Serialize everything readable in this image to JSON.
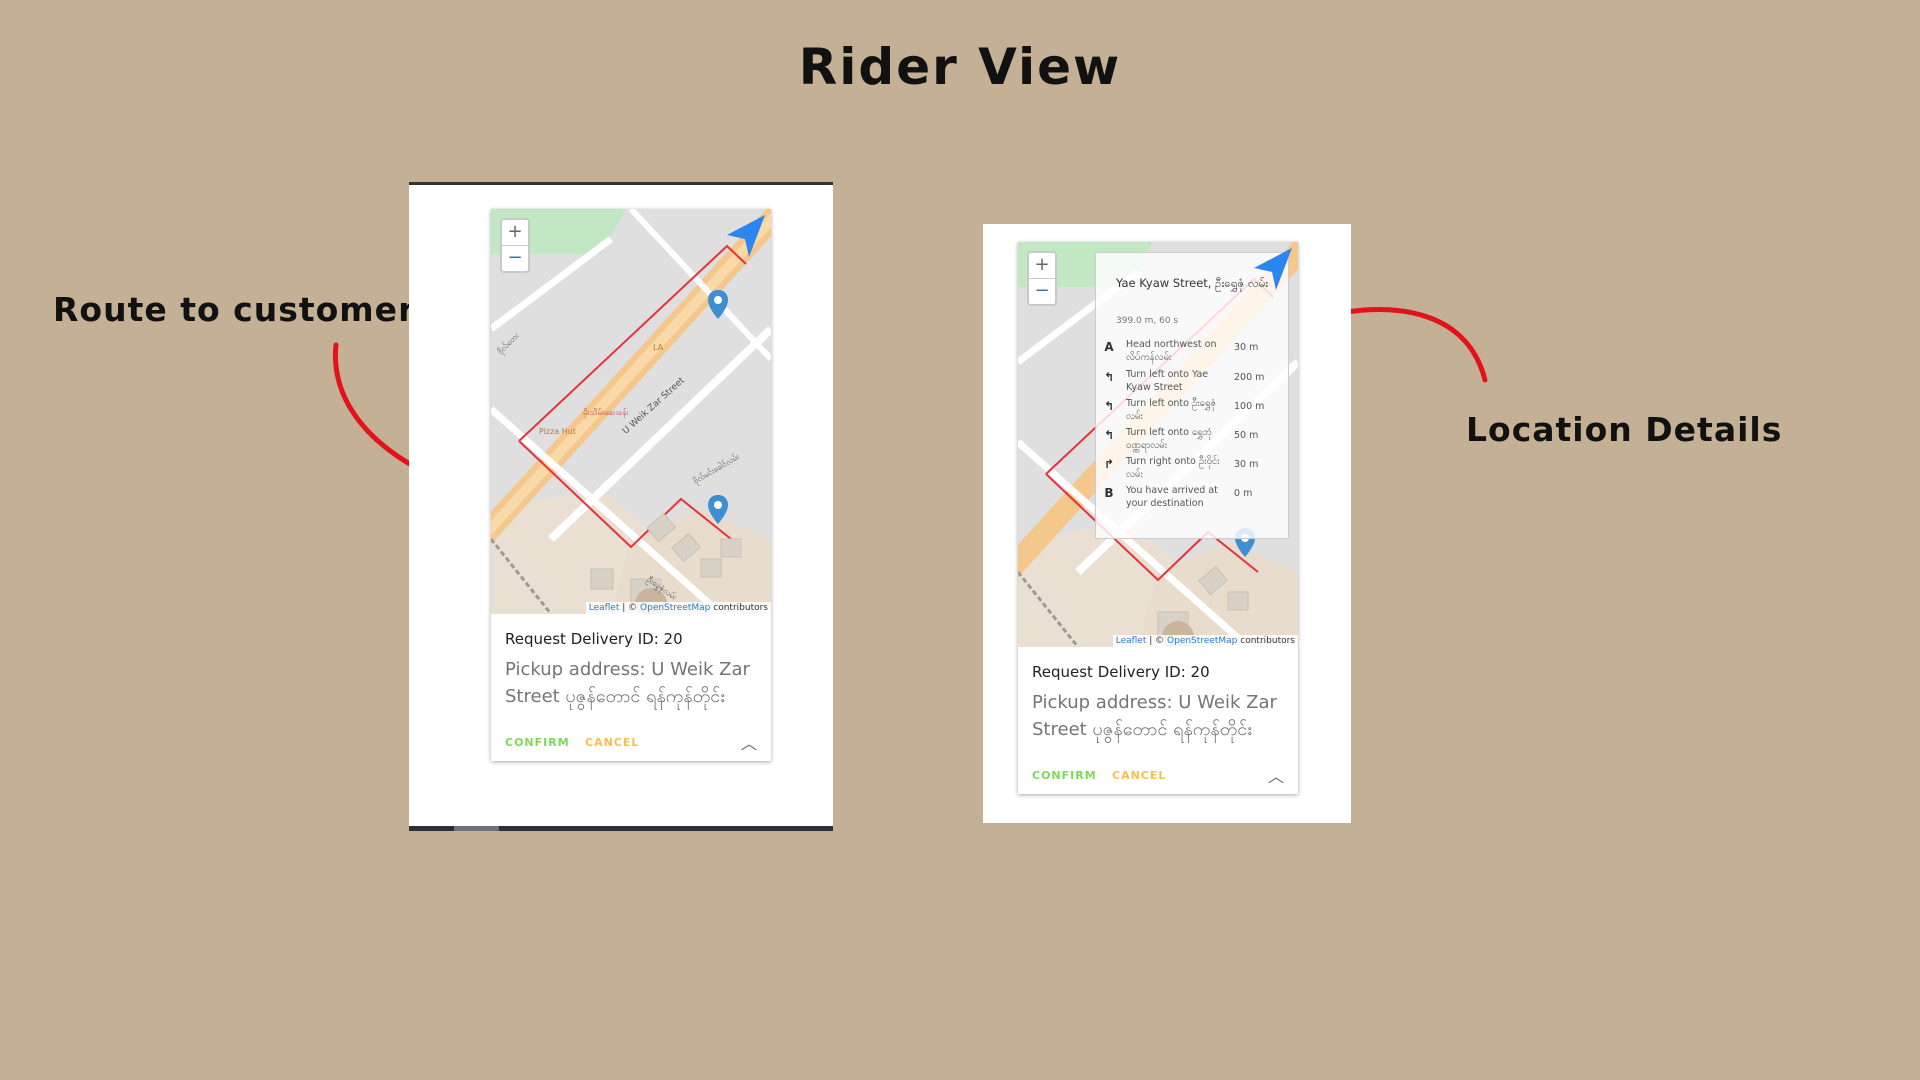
{
  "page": {
    "title": "Rider View"
  },
  "annotations": {
    "left": "Route to customers",
    "right": "Location Details"
  },
  "colors": {
    "background": "#c4b095",
    "route": "#e8313a",
    "marker": "#3d8fd1",
    "confirm": "#7ed957",
    "cancel": "#f7c046",
    "arrow": "#e3131b"
  },
  "map": {
    "zoom_in": "+",
    "zoom_out": "−",
    "attribution_leaflet": "Leaflet",
    "attribution_sep": " | © ",
    "attribution_osm": "OpenStreetMap",
    "attribution_rest": " contributors",
    "labels": {
      "street": "U Weik Zar Street",
      "poi1": "Pizza Hut",
      "poi2": "LA",
      "poi3": "မိုးသိမ်းဆေးခန်း",
      "side1": "ဗိုလ်တေး",
      "side2": "ဗိုလ်မင်းခေါင်လမ်း",
      "side3": "ဦးခွေဇုံလမ်း"
    }
  },
  "card": {
    "request_label": "Request Delivery ID: 20",
    "pickup": "Pickup address: U Weik Zar Street ပုဇွန်တောင် ရန်ကုန်တိုင်း",
    "confirm": "CONFIRM",
    "cancel": "CANCEL",
    "expand_icon": "chevron-up-icon"
  },
  "route_panel": {
    "name": "Yae Kyaw Street, ဦးရွှေဇုံ လမ်း",
    "summary": "399.0 m, 60 s",
    "steps": [
      {
        "icon": "A",
        "text": "Head northwest on လိပ်ကန်လမ်း",
        "dist": "30 m"
      },
      {
        "icon": "↰",
        "text": "Turn left onto Yae Kyaw Street",
        "dist": "200 m"
      },
      {
        "icon": "↰",
        "text": "Turn left onto ဦးရွှေဇုံ လမ်း",
        "dist": "100 m"
      },
      {
        "icon": "↰",
        "text": "Turn left onto ရွှေဘုံ ဝဏ္ဏရာလမ်း",
        "dist": "50 m"
      },
      {
        "icon": "↱",
        "text": "Turn right onto ဦးဝိုင်း လမ်း",
        "dist": "30 m"
      },
      {
        "icon": "B",
        "text": "You have arrived at your destination",
        "dist": "0 m"
      }
    ]
  }
}
